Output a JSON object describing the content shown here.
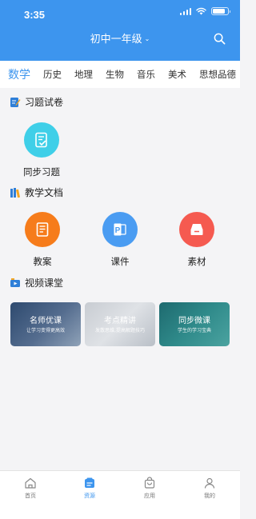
{
  "status_bar": {
    "time": "3:35",
    "battery_level": 0.85
  },
  "header": {
    "title": "初中一年级",
    "search_icon": "search-icon",
    "dropdown_icon": "chevron-down-icon"
  },
  "tabs": [
    {
      "label": "数学",
      "active": true
    },
    {
      "label": "历史"
    },
    {
      "label": "地理"
    },
    {
      "label": "生物"
    },
    {
      "label": "音乐"
    },
    {
      "label": "美术"
    },
    {
      "label": "思想品德"
    }
  ],
  "sections": {
    "exercises": {
      "title": "习题试卷",
      "items": [
        {
          "label": "同步习题",
          "icon": "edit-document-icon",
          "color": "#3fcfe8"
        }
      ]
    },
    "documents": {
      "title": "教学文档",
      "items": [
        {
          "label": "教案",
          "icon": "lesson-plan-icon",
          "color": "#f67c1b"
        },
        {
          "label": "课件",
          "icon": "powerpoint-icon",
          "color": "#4a9cf2"
        },
        {
          "label": "素材",
          "icon": "archive-box-icon",
          "color": "#f55a50"
        }
      ]
    },
    "video": {
      "title": "视频课堂",
      "cards": [
        {
          "title": "名师优课",
          "subtitle": "让学习变得更高效"
        },
        {
          "title": "考点精讲",
          "subtitle": "发散思维,提高解题技巧"
        },
        {
          "title": "同步微课",
          "subtitle": "学生的学习宝典"
        }
      ]
    }
  },
  "navbar": {
    "items": [
      {
        "label": "首页",
        "icon": "home-icon"
      },
      {
        "label": "资源",
        "icon": "resources-icon",
        "active": true
      },
      {
        "label": "应用",
        "icon": "shopping-bag-icon"
      },
      {
        "label": "我的",
        "icon": "profile-icon"
      }
    ]
  },
  "colors": {
    "primary": "#3d95ee"
  }
}
